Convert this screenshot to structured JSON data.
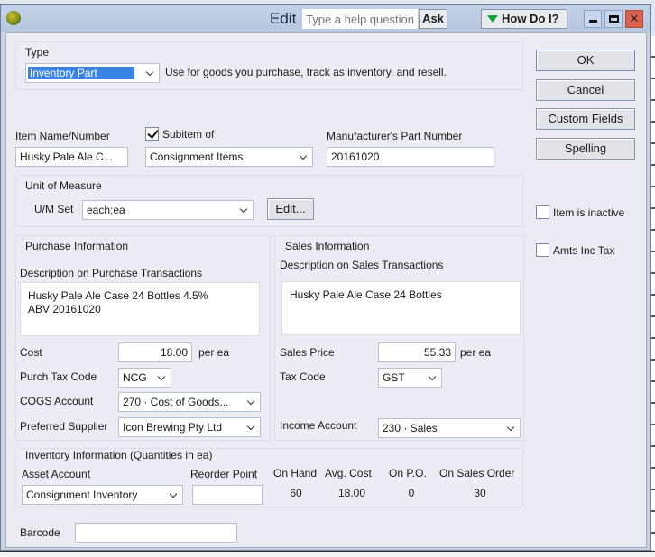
{
  "window": {
    "title": "Edit",
    "help_placeholder": "Type a help question",
    "ask_label": "Ask",
    "how_do_i_label": "How Do I?",
    "controls": [
      "minimize",
      "maximize",
      "close"
    ]
  },
  "type_section": {
    "label": "Type",
    "selected": "Inventory Part",
    "description": "Use for goods you purchase, track as inventory, and resell."
  },
  "buttons": {
    "ok": "OK",
    "cancel": "Cancel",
    "custom_fields": "Custom Fields",
    "spelling": "Spelling",
    "um_edit": "Edit..."
  },
  "item": {
    "name_label": "Item Name/Number",
    "name_value": "Husky Pale Ale C...",
    "subitem_label": "Subitem of",
    "subitem_checked": true,
    "subitem_value": "Consignment Items",
    "mpn_label": "Manufacturer's Part Number",
    "mpn_value": "20161020"
  },
  "unit_of_measure": {
    "label": "Unit of Measure",
    "set_label": "U/M Set",
    "set_value": "each:ea"
  },
  "options": {
    "inactive_label": "Item is inactive",
    "inactive_checked": false,
    "amts_inc_tax_label": "Amts Inc Tax",
    "amts_inc_tax_checked": false
  },
  "purchase": {
    "heading": "Purchase Information",
    "desc_label": "Description on Purchase Transactions",
    "desc_value": "Husky Pale Ale Case 24 Bottles 4.5%\nABV 20161020",
    "cost_label": "Cost",
    "cost_value": "18.00",
    "cost_unit": "per ea",
    "tax_code_label": "Purch Tax Code",
    "tax_code_value": "NCG",
    "cogs_label": "COGS Account",
    "cogs_value": "270 · Cost of Goods...",
    "supplier_label": "Preferred Supplier",
    "supplier_value": "Icon Brewing Pty Ltd"
  },
  "sales": {
    "heading": "Sales Information",
    "desc_label": "Description on Sales Transactions",
    "desc_value": "Husky Pale Ale Case 24 Bottles",
    "price_label": "Sales Price",
    "price_value": "55.33",
    "price_unit": "per ea",
    "tax_code_label": "Tax Code",
    "tax_code_value": "GST",
    "income_label": "Income Account",
    "income_value": "230 · Sales"
  },
  "inventory": {
    "heading": "Inventory Information (Quantities in ea)",
    "asset_label": "Asset Account",
    "asset_value": "Consignment Inventory",
    "reorder_label": "Reorder Point",
    "reorder_value": "",
    "on_hand_label": "On Hand",
    "on_hand_value": "60",
    "avg_cost_label": "Avg. Cost",
    "avg_cost_value": "18.00",
    "on_po_label": "On P.O.",
    "on_po_value": "0",
    "on_so_label": "On Sales Order",
    "on_so_value": "30"
  },
  "barcode": {
    "label": "Barcode",
    "value": ""
  }
}
